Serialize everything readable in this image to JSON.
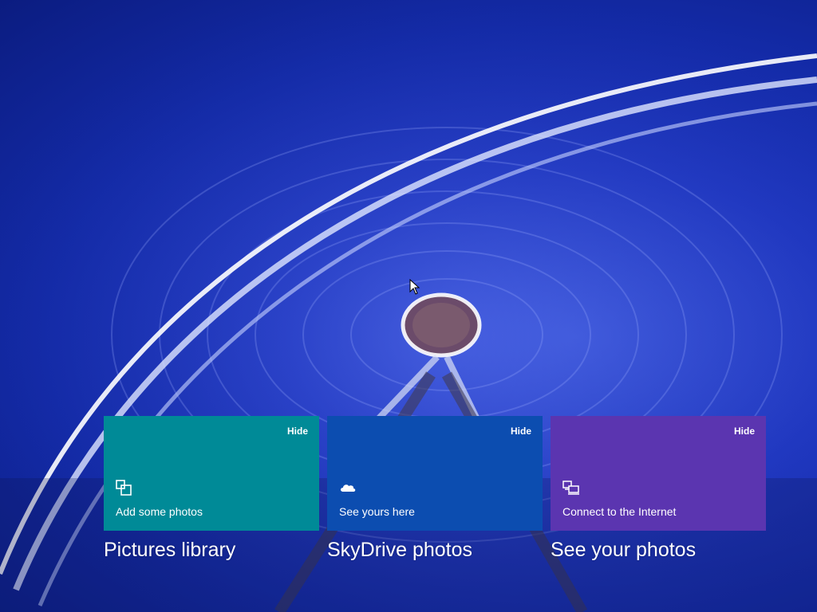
{
  "background": {
    "description_colors": {
      "sky": "#1a30b5",
      "ring": "#dfe6ff"
    }
  },
  "tiles": [
    {
      "hide_label": "Hide",
      "text": "Add some photos",
      "icon": "photos-import-icon",
      "color": "#008a97",
      "caption": "Pictures library"
    },
    {
      "hide_label": "Hide",
      "text": "See yours here",
      "icon": "cloud-icon",
      "color": "#0c4db0",
      "caption": "SkyDrive photos"
    },
    {
      "hide_label": "Hide",
      "text": "Connect to the Internet",
      "icon": "devices-icon",
      "color": "#5b35b0",
      "caption": "See your photos"
    }
  ]
}
